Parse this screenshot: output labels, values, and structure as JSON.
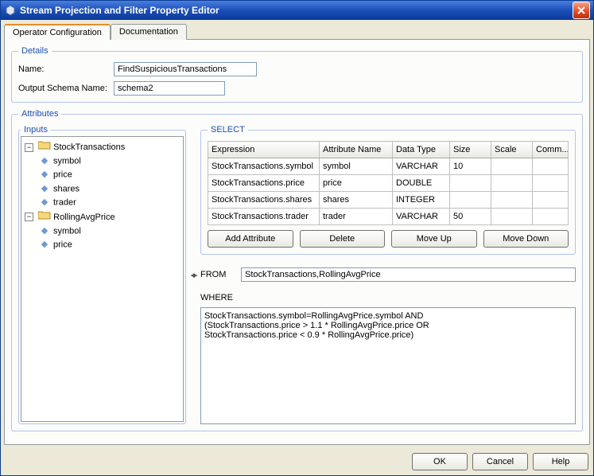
{
  "window": {
    "title": "Stream Projection and Filter Property Editor"
  },
  "tabs": [
    {
      "label": "Operator Configuration",
      "active": true
    },
    {
      "label": "Documentation",
      "active": false
    }
  ],
  "details": {
    "legend": "Details",
    "name_label": "Name:",
    "name_value": "FindSuspiciousTransactions",
    "schema_label": "Output Schema Name:",
    "schema_value": "schema2"
  },
  "attributes": {
    "legend": "Attributes",
    "inputs_legend": "Inputs",
    "select_legend": "SELECT",
    "inputs_tree": [
      {
        "label": "StockTransactions",
        "children": [
          {
            "label": "symbol"
          },
          {
            "label": "price"
          },
          {
            "label": "shares"
          },
          {
            "label": "trader"
          }
        ]
      },
      {
        "label": "RollingAvgPrice",
        "children": [
          {
            "label": "symbol"
          },
          {
            "label": "price"
          }
        ]
      }
    ],
    "select_columns": {
      "expression": "Expression",
      "attr_name": "Attribute Name",
      "data_type": "Data Type",
      "size": "Size",
      "scale": "Scale",
      "comm": "Comm..."
    },
    "select_rows": [
      {
        "expression": "StockTransactions.symbol",
        "attr_name": "symbol",
        "data_type": "VARCHAR",
        "size": "10",
        "scale": "",
        "comm": ""
      },
      {
        "expression": "StockTransactions.price",
        "attr_name": "price",
        "data_type": "DOUBLE",
        "size": "",
        "scale": "",
        "comm": ""
      },
      {
        "expression": "StockTransactions.shares",
        "attr_name": "shares",
        "data_type": "INTEGER",
        "size": "",
        "scale": "",
        "comm": ""
      },
      {
        "expression": "StockTransactions.trader",
        "attr_name": "trader",
        "data_type": "VARCHAR",
        "size": "50",
        "scale": "",
        "comm": ""
      }
    ],
    "buttons": {
      "add": "Add Attribute",
      "delete": "Delete",
      "move_up": "Move Up",
      "move_down": "Move Down"
    },
    "from_label": "FROM",
    "from_value": "StockTransactions,RollingAvgPrice",
    "where_label": "WHERE",
    "where_value": "StockTransactions.symbol=RollingAvgPrice.symbol AND\n(StockTransactions.price > 1.1 * RollingAvgPrice.price OR\nStockTransactions.price < 0.9 * RollingAvgPrice.price)"
  },
  "footer": {
    "ok": "OK",
    "cancel": "Cancel",
    "help": "Help"
  }
}
